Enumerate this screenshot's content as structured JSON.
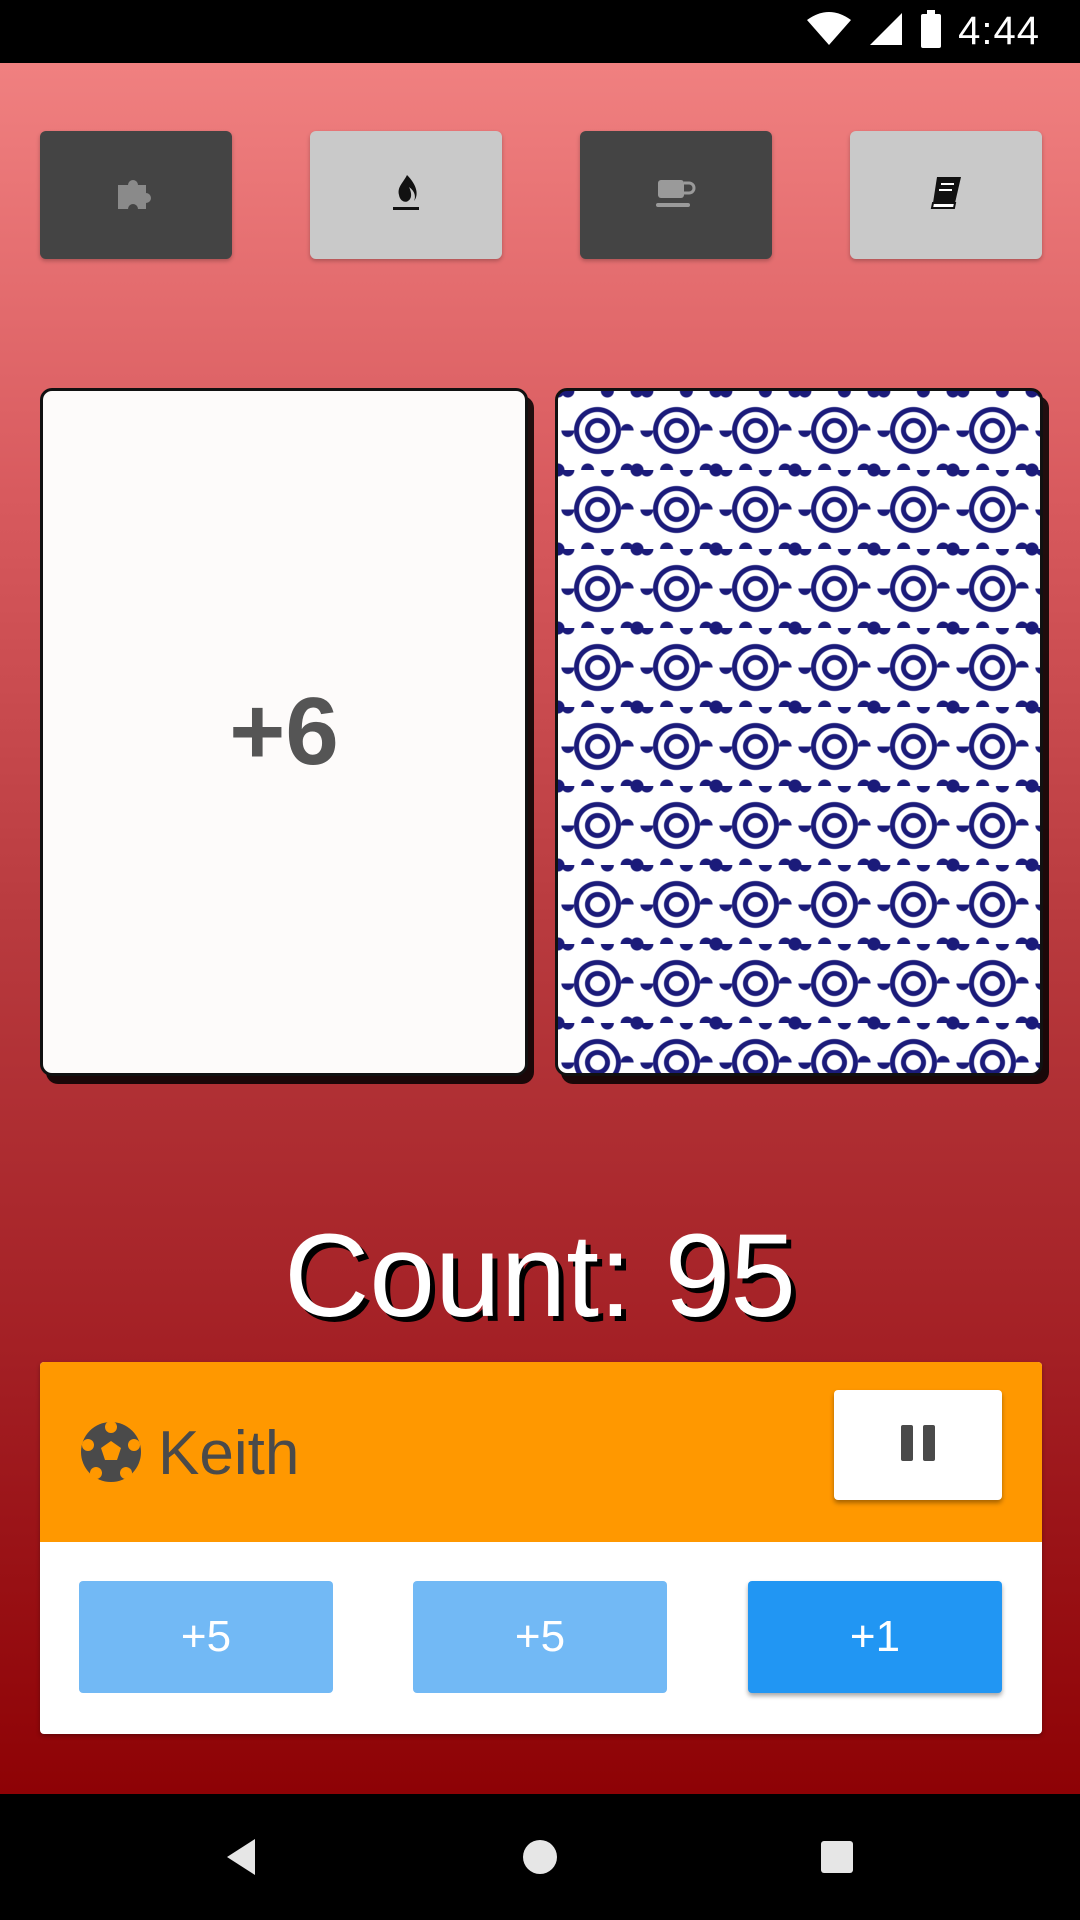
{
  "status_bar": {
    "time": "4:44",
    "icons": [
      "wifi-icon",
      "signal-icon",
      "battery-icon"
    ]
  },
  "mode_buttons": [
    {
      "icon": "puzzle-icon",
      "style": "dark"
    },
    {
      "icon": "fire-icon",
      "style": "light"
    },
    {
      "icon": "coffee-icon",
      "style": "dark"
    },
    {
      "icon": "book-icon",
      "style": "light"
    }
  ],
  "cards": {
    "face_value": "+6",
    "back_pattern": "navy-circle-pattern"
  },
  "count": {
    "text": "Count: 95"
  },
  "player": {
    "icon": "soccer-ball-icon",
    "name": "Keith",
    "header_color": "#ff9800",
    "pause_icon": "pause-icon",
    "buttons": [
      {
        "label": "+5",
        "enabled": false
      },
      {
        "label": "+5",
        "enabled": false
      },
      {
        "label": "+1",
        "enabled": true
      }
    ]
  },
  "nav_bar": {
    "icons": [
      "back-icon",
      "home-icon",
      "recents-icon"
    ]
  },
  "colors": {
    "gradient_top": "#f08080",
    "gradient_bottom": "#8e0205",
    "button_active": "#2196f3",
    "button_disabled": "#72b9f5",
    "card_pattern": "#1b1b7a"
  }
}
